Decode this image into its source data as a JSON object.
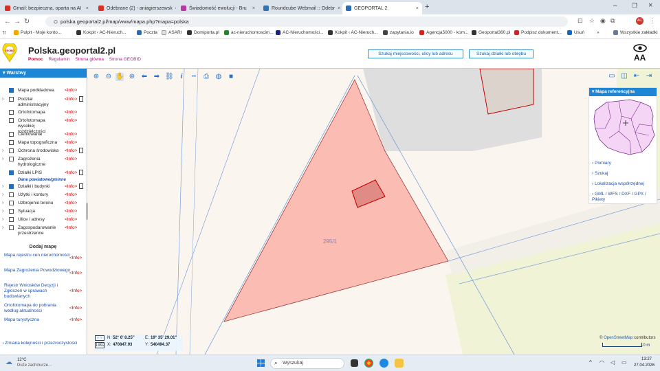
{
  "browser": {
    "tabs": [
      {
        "label": "Gmail: bezpieczna, oparta na AI",
        "color": "#d93025"
      },
      {
        "label": "Odebrane (2) - aniagierszewsk",
        "color": "#d93025"
      },
      {
        "label": "Świadomość ewolucji - Bru",
        "color": "#b83aa0"
      },
      {
        "label": "Roundcube Webmail :: Odebr",
        "color": "#3572b0"
      },
      {
        "label": "GEOPORTAL 2",
        "color": "#2b6cb0"
      }
    ],
    "active_tab": 4,
    "new_tab": "+",
    "url": "polska.geoportal2.pl/map/www/mapa.php?mapa=polska",
    "bookmarks": [
      {
        "label": "Pulpit - Moje konto...",
        "color": "#f2a900"
      },
      {
        "label": "Kokpit ‹ AC-Nieruch...",
        "color": "#333333"
      },
      {
        "label": "Poczta",
        "color": "#2b6cb0"
      },
      {
        "label": "ASARI",
        "color": "#e0e0e0"
      },
      {
        "label": "Domiporta.pl",
        "color": "#333333"
      },
      {
        "label": "ac-nieruchomoscim...",
        "color": "#2e7d32"
      },
      {
        "label": "AC-Nieruchomości...",
        "color": "#1a237e"
      },
      {
        "label": "Kokpit ‹ AC-Nieruch...",
        "color": "#333333"
      },
      {
        "label": "zapytania.io",
        "color": "#444444"
      },
      {
        "label": "Agencja5000 - kom...",
        "color": "#c62828"
      },
      {
        "label": "Geoportal360.pl",
        "color": "#333333"
      },
      {
        "label": "Podpisz dokument...",
        "color": "#c62828"
      },
      {
        "label": "Usuń",
        "color": "#1565c0"
      }
    ],
    "more_bookmarks": "»",
    "all_bookmarks": "Wszystkie zakładki",
    "profile_initials": "AC"
  },
  "header": {
    "title": "Polska.geoportal2.pl",
    "logo_text": "GEOBID",
    "links": [
      "Pomoc",
      "Regulamin",
      "Strona główna",
      "Strona GEOBID"
    ],
    "search_place_button": "Szukaj miejscowości, ulicy lub adresu",
    "search_parcel_button": "Szukaj działki lub obrębu",
    "font_size_label": "AA"
  },
  "layers_panel": {
    "title": "Warstwy",
    "layers": [
      {
        "name": "Mapa podkładowa",
        "checked": true,
        "expand": false,
        "info": "<Info>",
        "doc": false
      },
      {
        "name": "Podział administracyjny",
        "checked": false,
        "expand": true,
        "info": "<Info>",
        "doc": true
      },
      {
        "name": "Ortofotomapa",
        "checked": false,
        "expand": false,
        "info": "<Info>",
        "doc": false
      },
      {
        "name": "Ortofotomapa wysokiej rozdzielczości",
        "checked": false,
        "expand": false,
        "info": "<Info>",
        "doc": false
      },
      {
        "name": "Cieniowanie",
        "checked": false,
        "expand": false,
        "info": "<Info>",
        "doc": false
      },
      {
        "name": "Mapa topograficzna",
        "checked": false,
        "expand": false,
        "info": "<Info>",
        "doc": false
      },
      {
        "name": "Ochrona środowiska",
        "checked": false,
        "expand": true,
        "info": "<Info>",
        "doc": true
      },
      {
        "name": "Zagrożenia hydrologiczne",
        "checked": false,
        "expand": true,
        "info": "<Info>",
        "doc": false
      },
      {
        "name": "Działki LPIS",
        "checked": true,
        "expand": false,
        "info": "<Info>",
        "doc": true
      },
      {
        "name": "Działki i budynki",
        "checked": true,
        "expand": true,
        "info": "<Info>",
        "doc": true
      },
      {
        "name": "Użytki i kontury",
        "checked": false,
        "expand": true,
        "info": "<Info>",
        "doc": false
      },
      {
        "name": "Uzbrojenie terenu",
        "checked": false,
        "expand": true,
        "info": "<Info>",
        "doc": false
      },
      {
        "name": "Sytuacja",
        "checked": false,
        "expand": true,
        "info": "<Info>",
        "doc": false
      },
      {
        "name": "Ulice i adresy",
        "checked": false,
        "expand": true,
        "info": "<Info>",
        "doc": false
      },
      {
        "name": "Zagospodarowanie przestrzenne",
        "checked": false,
        "expand": true,
        "info": "<Info>",
        "doc": false
      }
    ],
    "sub_link": "Dane powiatowe/gminne",
    "add_map_title": "Dodaj mapę",
    "maps": [
      {
        "name": "Mapa rejestru cen nieruchomości",
        "info": "<Info>"
      },
      {
        "name": "Mapa Zagrożenia Powodziowego",
        "info": "<Info>"
      },
      {
        "name": "Rejestr Wniosków Decyzji i Zgłoszeń w sprawach budowlanych",
        "info": "<Info>"
      },
      {
        "name": "Ortofotomapa do pobrania według aktualności",
        "info": "<Info>"
      },
      {
        "name": "Mapa turystyczna",
        "info": "<Info>"
      }
    ],
    "footer_link": "Zmiana kolejności i przezroczystości"
  },
  "map": {
    "parcel_label": "295/1",
    "reference_title": "Mapa referencyjna",
    "reference_links": [
      "Pomiary",
      "Szukaj",
      "Lokalizacja współrzędnej",
      "GML / WFS / DXF / GPX / Pikiety"
    ],
    "coords": {
      "system": "1992",
      "n_label": "N:",
      "n_value": "52° 6' 8.25\"",
      "e_label": "E:",
      "e_value": "19° 35' 29.01\"",
      "x_label": "X:",
      "x_value": "470847.93",
      "y_label": "Y:",
      "y_value": "540494.37"
    },
    "attribution_prefix": "© ",
    "attribution_link": "OpenStreetMap",
    "attribution_suffix": " contributors",
    "scale_label": "10 m"
  },
  "taskbar": {
    "weather_temp": "12°C",
    "weather_desc": "Duże zachmurze...",
    "search_placeholder": "Wyszukaj",
    "time": "13:27",
    "date": "27.04.2026"
  }
}
